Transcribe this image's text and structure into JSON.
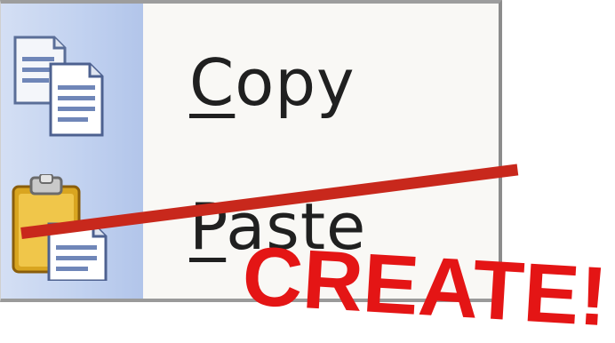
{
  "menu": {
    "items": [
      {
        "label": "Copy",
        "accelerator": "C",
        "rest": "opy",
        "icon": "copy-icon"
      },
      {
        "label": "Paste",
        "accelerator": "P",
        "rest": "aste",
        "icon": "paste-icon"
      }
    ]
  },
  "overlay": {
    "stamp_text": "CREATE!",
    "stamp_color": "#e41515",
    "strike_color": "#c8281c"
  }
}
